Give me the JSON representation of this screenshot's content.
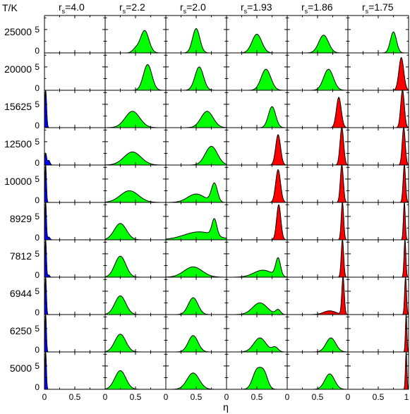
{
  "chart_data": {
    "type": "area",
    "corner_label": "T/K",
    "columns": [
      {
        "base": "r",
        "sub": "s",
        "value": "=4.0"
      },
      {
        "base": "r",
        "sub": "s",
        "value": "=2.2"
      },
      {
        "base": "r",
        "sub": "s",
        "value": "=2.0"
      },
      {
        "base": "r",
        "sub": "s",
        "value": "=1.93"
      },
      {
        "base": "r",
        "sub": "s",
        "value": "=1.86"
      },
      {
        "base": "r",
        "sub": "s",
        "value": "=1.75"
      }
    ],
    "rows": [
      "25000",
      "20000",
      "15625",
      "12500",
      "10000",
      "8929",
      "7812",
      "6944",
      "6250",
      "5000"
    ],
    "y_ticks": [
      "0",
      "5"
    ],
    "y_range": [
      0,
      8
    ],
    "x_range": [
      0,
      1
    ],
    "x_tick_labels": [
      "0",
      "0.5",
      "1"
    ],
    "xlabel": "η",
    "phase_colors": {
      "blue": "#0000ff",
      "green": "#00ff00",
      "red": "#ff0000"
    },
    "distributions": [
      [
        {
          "phase": "none"
        },
        {
          "phase": "green",
          "peaks": [
            [
              0.65,
              0.07,
              4.8
            ],
            [
              0.5,
              0.05,
              0.8
            ]
          ]
        },
        {
          "phase": "green",
          "peaks": [
            [
              0.5,
              0.06,
              5.2
            ]
          ]
        },
        {
          "phase": "green",
          "peaks": [
            [
              0.5,
              0.08,
              4.0
            ]
          ]
        },
        {
          "phase": "green",
          "peaks": [
            [
              0.6,
              0.08,
              3.8
            ]
          ]
        },
        {
          "phase": "green",
          "peaks": [
            [
              0.75,
              0.05,
              4.5
            ]
          ]
        }
      ],
      [
        {
          "phase": "none"
        },
        {
          "phase": "green",
          "peaks": [
            [
              0.7,
              0.07,
              5.5
            ]
          ]
        },
        {
          "phase": "green",
          "peaks": [
            [
              0.55,
              0.07,
              5.0
            ]
          ]
        },
        {
          "phase": "green",
          "peaks": [
            [
              0.65,
              0.08,
              4.5
            ]
          ]
        },
        {
          "phase": "green",
          "peaks": [
            [
              0.68,
              0.08,
              4.5
            ]
          ]
        },
        {
          "phase": "red",
          "peaks": [
            [
              0.88,
              0.04,
              7.0
            ]
          ]
        }
      ],
      [
        {
          "phase": "blue",
          "peaks": [
            [
              0.02,
              0.015,
              8.0
            ]
          ]
        },
        {
          "phase": "green",
          "peaks": [
            [
              0.45,
              0.12,
              3.5
            ]
          ]
        },
        {
          "phase": "green",
          "peaks": [
            [
              0.68,
              0.1,
              3.5
            ]
          ]
        },
        {
          "phase": "green",
          "peaks": [
            [
              0.75,
              0.06,
              4.5
            ]
          ]
        },
        {
          "phase": "red",
          "peaks": [
            [
              0.85,
              0.04,
              6.5
            ]
          ]
        },
        {
          "phase": "red",
          "peaks": [
            [
              0.9,
              0.03,
              8.0
            ]
          ]
        }
      ],
      [
        {
          "phase": "blue",
          "peaks": [
            [
              0.02,
              0.015,
              2.5
            ],
            [
              0.07,
              0.02,
              1.0
            ]
          ]
        },
        {
          "phase": "green",
          "peaks": [
            [
              0.45,
              0.14,
              2.8
            ]
          ]
        },
        {
          "phase": "green",
          "peaks": [
            [
              0.75,
              0.1,
              4.0
            ]
          ]
        },
        {
          "phase": "red",
          "peaks": [
            [
              0.85,
              0.04,
              6.5
            ]
          ]
        },
        {
          "phase": "red",
          "peaks": [
            [
              0.9,
              0.03,
              8.0
            ]
          ]
        },
        {
          "phase": "red",
          "peaks": [
            [
              0.92,
              0.025,
              8.0
            ]
          ]
        }
      ],
      [
        {
          "phase": "blue",
          "peaks": [
            [
              0.02,
              0.012,
              8.0
            ]
          ]
        },
        {
          "phase": "green",
          "peaks": [
            [
              0.4,
              0.15,
              2.5
            ]
          ]
        },
        {
          "phase": "green",
          "peaks": [
            [
              0.5,
              0.14,
              1.8
            ],
            [
              0.8,
              0.05,
              4.0
            ]
          ]
        },
        {
          "phase": "red",
          "peaks": [
            [
              0.85,
              0.04,
              7.0
            ]
          ]
        },
        {
          "phase": "red",
          "peaks": [
            [
              0.9,
              0.025,
              8.0
            ]
          ]
        },
        {
          "phase": "red",
          "peaks": [
            [
              0.93,
              0.02,
              8.0
            ]
          ]
        }
      ],
      [
        {
          "phase": "blue",
          "peaks": [
            [
              0.02,
              0.012,
              8.0
            ],
            [
              0.07,
              0.02,
              0.6
            ]
          ]
        },
        {
          "phase": "green",
          "peaks": [
            [
              0.25,
              0.1,
              3.5
            ]
          ]
        },
        {
          "phase": "green",
          "peaks": [
            [
              0.55,
              0.25,
              1.7
            ],
            [
              0.8,
              0.04,
              3.5
            ]
          ]
        },
        {
          "phase": "red",
          "peaks": [
            [
              0.86,
              0.035,
              7.5
            ]
          ]
        },
        {
          "phase": "red",
          "peaks": [
            [
              0.91,
              0.02,
              8.0
            ]
          ]
        },
        {
          "phase": "red",
          "peaks": [
            [
              0.93,
              0.015,
              8.0
            ]
          ]
        }
      ],
      [
        {
          "phase": "blue",
          "peaks": [
            [
              0.02,
              0.012,
              8.0
            ],
            [
              0.07,
              0.015,
              0.5
            ]
          ]
        },
        {
          "phase": "green",
          "peaks": [
            [
              0.25,
              0.09,
              4.5
            ]
          ]
        },
        {
          "phase": "green",
          "peaks": [
            [
              0.45,
              0.15,
              2.2
            ]
          ]
        },
        {
          "phase": "green",
          "peaks": [
            [
              0.6,
              0.15,
              1.5
            ],
            [
              0.85,
              0.04,
              3.8
            ]
          ]
        },
        {
          "phase": "red",
          "peaks": [
            [
              0.91,
              0.02,
              8.0
            ]
          ]
        },
        {
          "phase": "red",
          "peaks": [
            [
              0.94,
              0.015,
              8.0
            ]
          ]
        }
      ],
      [
        {
          "phase": "blue",
          "peaks": [
            [
              0.02,
              0.012,
              8.0
            ]
          ]
        },
        {
          "phase": "green",
          "peaks": [
            [
              0.25,
              0.09,
              4.0
            ]
          ]
        },
        {
          "phase": "green",
          "peaks": [
            [
              0.45,
              0.08,
              3.6
            ]
          ]
        },
        {
          "phase": "green",
          "peaks": [
            [
              0.55,
              0.12,
              2.5
            ],
            [
              0.85,
              0.04,
              1.0
            ]
          ]
        },
        {
          "phase": "red",
          "peaks": [
            [
              0.7,
              0.1,
              0.8
            ],
            [
              0.92,
              0.02,
              8.0
            ]
          ]
        },
        {
          "phase": "red",
          "peaks": [
            [
              0.95,
              0.015,
              8.0
            ]
          ]
        }
      ],
      [
        {
          "phase": "blue",
          "peaks": [
            [
              0.02,
              0.012,
              8.0
            ]
          ]
        },
        {
          "phase": "green",
          "peaks": [
            [
              0.25,
              0.09,
              3.8
            ]
          ]
        },
        {
          "phase": "green",
          "peaks": [
            [
              0.45,
              0.08,
              3.5
            ]
          ]
        },
        {
          "phase": "green",
          "peaks": [
            [
              0.55,
              0.1,
              3.0
            ],
            [
              0.8,
              0.05,
              1.0
            ]
          ]
        },
        {
          "phase": "green",
          "peaks": [
            [
              0.72,
              0.08,
              3.0
            ]
          ]
        },
        {
          "phase": "red",
          "peaks": [
            [
              0.96,
              0.012,
              8.0
            ]
          ]
        }
      ],
      [
        {
          "phase": "blue",
          "peaks": [
            [
              0.02,
              0.012,
              8.0
            ]
          ]
        },
        {
          "phase": "green",
          "peaks": [
            [
              0.25,
              0.09,
              4.0
            ]
          ]
        },
        {
          "phase": "green",
          "peaks": [
            [
              0.45,
              0.1,
              3.5
            ]
          ]
        },
        {
          "phase": "green",
          "peaks": [
            [
              0.5,
              0.07,
              4.0
            ],
            [
              0.62,
              0.06,
              3.2
            ]
          ]
        },
        {
          "phase": "green",
          "peaks": [
            [
              0.7,
              0.08,
              3.3
            ]
          ]
        },
        {
          "phase": "red",
          "peaks": [
            [
              0.96,
              0.012,
              8.0
            ]
          ]
        }
      ]
    ]
  }
}
